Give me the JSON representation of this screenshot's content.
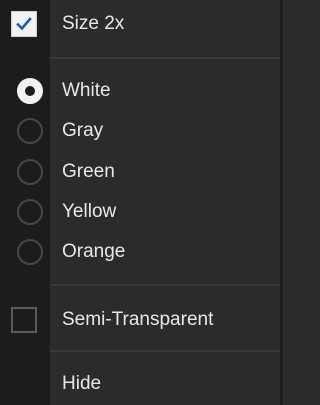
{
  "menu": {
    "size2x": {
      "label": "Size 2x",
      "checked": true
    },
    "colors": [
      {
        "label": "White",
        "selected": true
      },
      {
        "label": "Gray",
        "selected": false
      },
      {
        "label": "Green",
        "selected": false
      },
      {
        "label": "Yellow",
        "selected": false
      },
      {
        "label": "Orange",
        "selected": false
      }
    ],
    "semi_transparent": {
      "label": "Semi-Transparent",
      "checked": false
    },
    "hide": {
      "label": "Hide"
    }
  },
  "colors": {
    "background": "#2b2b2b",
    "gutter": "#1c1c1c",
    "text": "#e8e8e8",
    "check_fill": "#f2f2f2",
    "check_mark": "#1e5fa8"
  }
}
